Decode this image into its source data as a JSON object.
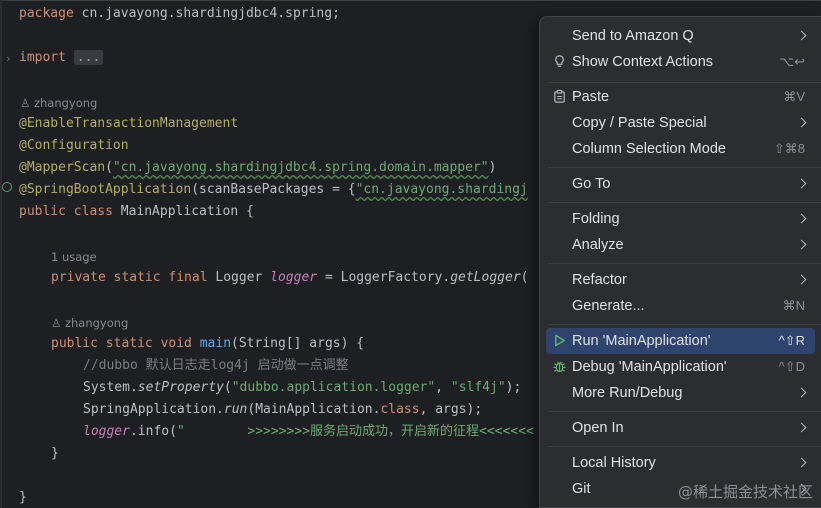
{
  "editor": {
    "line_package_kw": "package",
    "line_package_rest": " cn.javayong.shardingjdbc4.spring;",
    "line_import_kw": "import",
    "line_import_ellipsis": "...",
    "author1": "zhangyong",
    "ann_transaction": "@EnableTransactionManagement",
    "ann_configuration": "@Configuration",
    "ann_mapperscan": "@MapperScan",
    "mapperscan_open": "(",
    "mapperscan_str": "\"cn.javayong.shardingjdbc4.spring.domain.mapper\"",
    "mapperscan_close": ")",
    "ann_springboot": "@SpringBootApplication",
    "springboot_rest": "(scanBasePackages = {",
    "springboot_str": "\"cn.javayong.shardingj",
    "class_kw": "public class",
    "class_rest": " MainApplication {",
    "usage": "1 usage",
    "logger_kw": "private static final",
    "logger_type": " Logger ",
    "logger_field": "logger",
    "logger_eq": " = LoggerFactory.",
    "logger_method": "getLogger",
    "logger_tail": "(",
    "author2": "zhangyong",
    "main_kw": "public static void",
    "main_name": " main",
    "main_rest": "(String[] args) {",
    "comment_line": "//dubbo 默认日志走log4j 启动做一点调整",
    "setprop_a": "System.",
    "setprop_m": "setProperty",
    "setprop_b": "(",
    "setprop_s1": "\"dubbo.application.logger\"",
    "setprop_c": ", ",
    "setprop_s2": "\"slf4j\"",
    "setprop_d": ");",
    "run_a": "SpringApplication.",
    "run_m": "run",
    "run_b": "(MainApplication.",
    "run_kw": "class",
    "run_c": ", args);",
    "info_field": "logger",
    "info_b": ".info(",
    "info_str": "\"        >>>>>>>>服务启动成功，开启新的征程<<<<<<<",
    "close_brace_inner": "}",
    "close_brace_outer": "}"
  },
  "menu": {
    "items": [
      {
        "label": "Send to Amazon Q",
        "shortcut": "",
        "submenu": true
      },
      {
        "label": "Show Context Actions",
        "shortcut": "⌥↩",
        "submenu": false,
        "icon": "lightbulb-icon"
      },
      {
        "label": "Paste",
        "shortcut": "⌘V",
        "submenu": false,
        "icon": "clipboard-icon"
      },
      {
        "label": "Copy / Paste Special",
        "shortcut": "",
        "submenu": true
      },
      {
        "label": "Column Selection Mode",
        "shortcut": "⇧⌘8",
        "submenu": false
      },
      {
        "label": "Go To",
        "shortcut": "",
        "submenu": true
      },
      {
        "label": "Folding",
        "shortcut": "",
        "submenu": true
      },
      {
        "label": "Analyze",
        "shortcut": "",
        "submenu": true
      },
      {
        "label": "Refactor",
        "shortcut": "",
        "submenu": true
      },
      {
        "label": "Generate...",
        "shortcut": "⌘N",
        "submenu": false
      },
      {
        "label": "Run 'MainApplication'",
        "shortcut": "^⇧R",
        "submenu": false,
        "icon": "run-icon",
        "selected": true
      },
      {
        "label": "Debug 'MainApplication'",
        "shortcut": "^⇧D",
        "submenu": false,
        "icon": "debug-icon"
      },
      {
        "label": "More Run/Debug",
        "shortcut": "",
        "submenu": true
      },
      {
        "label": "Open In",
        "shortcut": "",
        "submenu": true
      },
      {
        "label": "Local History",
        "shortcut": "",
        "submenu": true
      },
      {
        "label": "Git",
        "shortcut": "",
        "submenu": true
      }
    ]
  },
  "watermark": "@稀土掘金技术社区",
  "colors": {
    "background": "#1e1f22",
    "menu_bg": "#2b2d30",
    "selection": "#2e436e",
    "keyword": "#cf8e6d",
    "annotation": "#b3ae60",
    "string": "#6aab73",
    "field": "#c77dbb"
  }
}
